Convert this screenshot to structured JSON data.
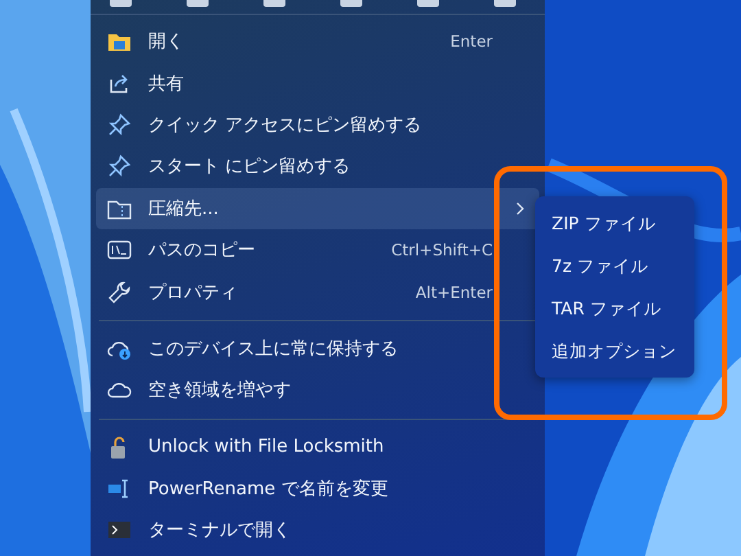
{
  "menu": {
    "items": [
      {
        "kind": "item",
        "label": "開く",
        "shortcut": "Enter",
        "selected": false
      },
      {
        "kind": "item",
        "label": "共有",
        "selected": false
      },
      {
        "kind": "item",
        "label": "クイック アクセスにピン留めする",
        "selected": false
      },
      {
        "kind": "item",
        "label": "スタート にピン留めする",
        "selected": false
      },
      {
        "kind": "item",
        "label": "圧縮先...",
        "selected": true,
        "submenu": [
          {
            "label": "ZIP ファイル"
          },
          {
            "label": "7z ファイル"
          },
          {
            "label": "TAR ファイル"
          },
          {
            "label": "追加オプション"
          }
        ]
      },
      {
        "kind": "item",
        "label": "パスのコピー",
        "shortcut": "Ctrl+Shift+C",
        "selected": false
      },
      {
        "kind": "item",
        "label": "プロパティ",
        "shortcut": "Alt+Enter",
        "selected": false
      },
      {
        "kind": "separator"
      },
      {
        "kind": "item",
        "label": "このデバイス上に常に保持する",
        "selected": false
      },
      {
        "kind": "item",
        "label": "空き領域を増やす",
        "selected": false
      },
      {
        "kind": "separator"
      },
      {
        "kind": "item",
        "label": "Unlock with File Locksmith",
        "selected": false
      },
      {
        "kind": "item",
        "label": "PowerRename で名前を変更",
        "selected": false
      },
      {
        "kind": "item",
        "label": "ターミナルで開く",
        "selected": false
      }
    ]
  }
}
